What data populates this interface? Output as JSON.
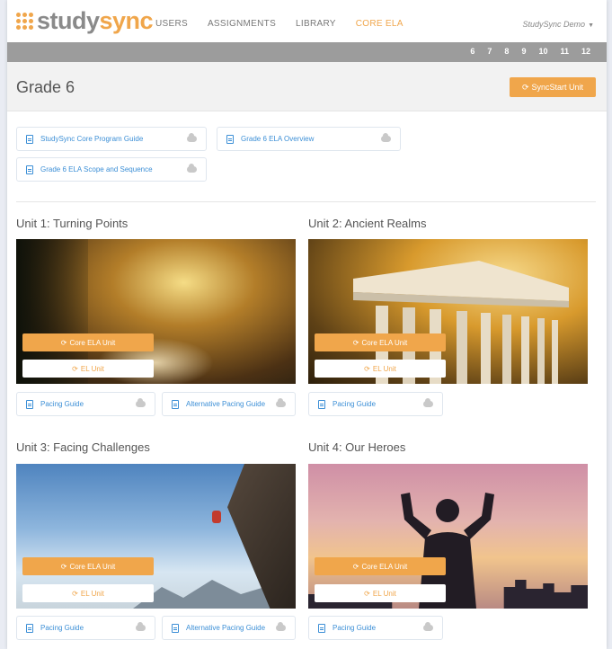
{
  "logo": {
    "text_main": "study",
    "text_accent": "sync"
  },
  "nav": {
    "items": [
      {
        "label": "USERS"
      },
      {
        "label": "ASSIGNMENTS"
      },
      {
        "label": "LIBRARY"
      },
      {
        "label": "CORE ELA"
      }
    ],
    "active": "CORE ELA"
  },
  "user_menu": {
    "label": "StudySync Demo"
  },
  "grades": [
    "6",
    "7",
    "8",
    "9",
    "10",
    "11",
    "12"
  ],
  "page": {
    "title": "Grade 6",
    "syncstart_label": "SyncStart Unit"
  },
  "resources": [
    {
      "label": "StudySync Core Program Guide"
    },
    {
      "label": "Grade 6 ELA Overview"
    },
    {
      "label": "Grade 6 ELA Scope and Sequence"
    }
  ],
  "units": [
    {
      "title": "Unit 1: Turning Points",
      "core_label": "Core ELA Unit",
      "el_label": "EL Unit",
      "guides": [
        "Pacing Guide",
        "Alternative Pacing Guide"
      ]
    },
    {
      "title": "Unit 2: Ancient Realms",
      "core_label": "Core ELA Unit",
      "el_label": "EL Unit",
      "guides": [
        "Pacing Guide"
      ]
    },
    {
      "title": "Unit 3: Facing Challenges",
      "core_label": "Core ELA Unit",
      "el_label": "EL Unit",
      "guides": [
        "Pacing Guide",
        "Alternative Pacing Guide"
      ]
    },
    {
      "title": "Unit 4: Our Heroes",
      "core_label": "Core ELA Unit",
      "el_label": "EL Unit",
      "guides": [
        "Pacing Guide"
      ]
    }
  ],
  "colors": {
    "accent": "#f0a64b",
    "link": "#3c8fd6",
    "grade_bar": "#9c9c9c"
  }
}
